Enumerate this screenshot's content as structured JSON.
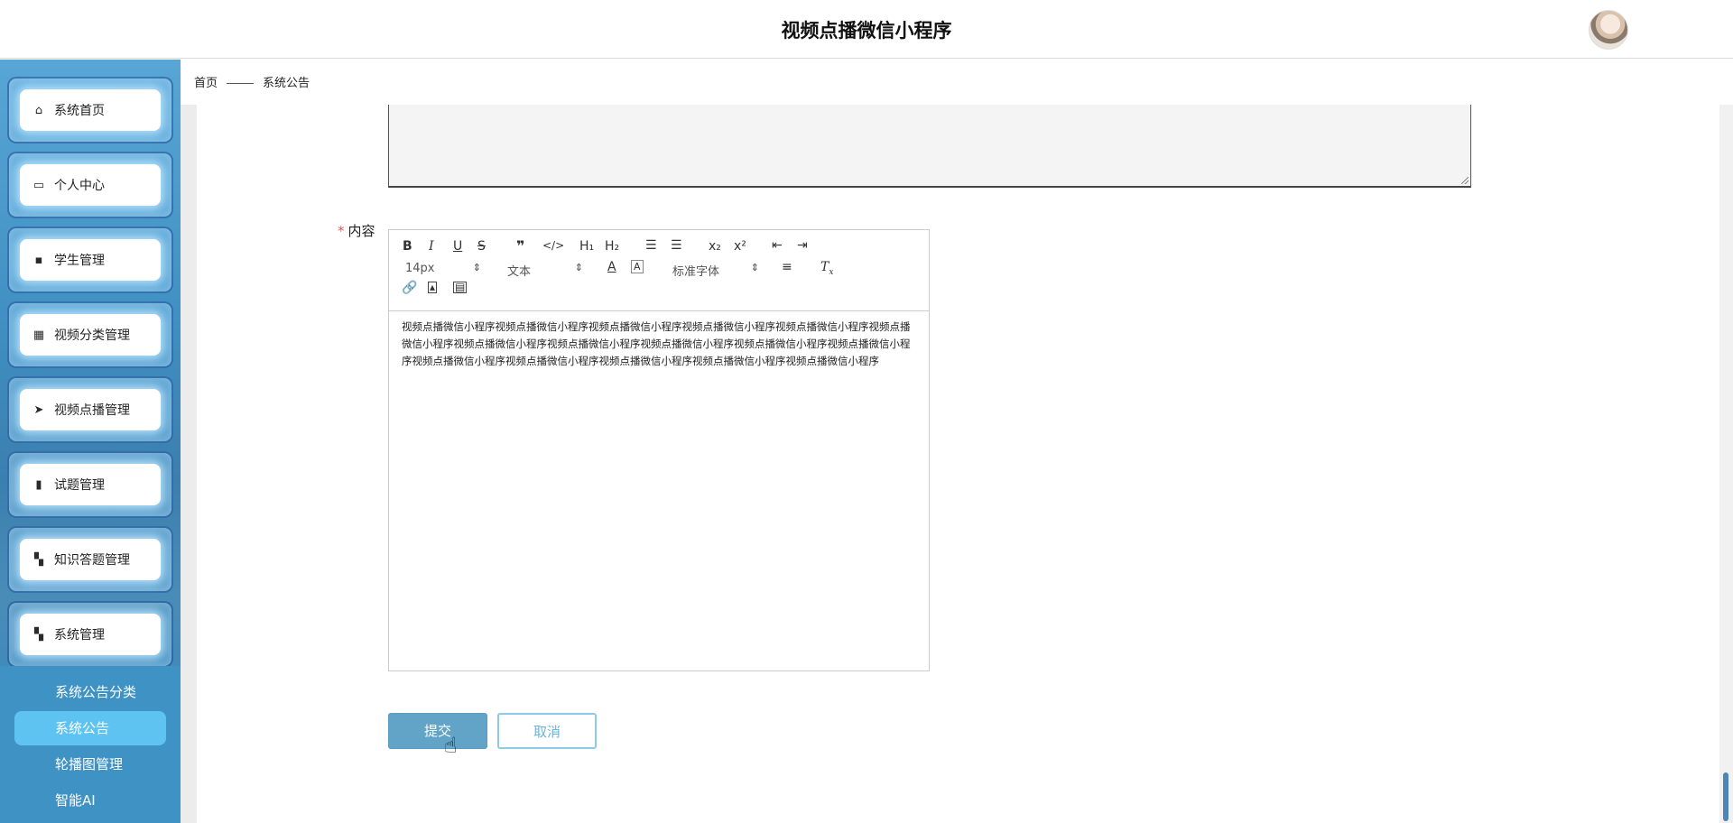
{
  "app": {
    "title": "视频点播微信小程序"
  },
  "sidebar": {
    "items": [
      {
        "label": "系统首页",
        "icon": "home-icon"
      },
      {
        "label": "个人中心",
        "icon": "card-icon"
      },
      {
        "label": "学生管理",
        "icon": "chat-icon"
      },
      {
        "label": "视频分类管理",
        "icon": "grid-icon"
      },
      {
        "label": "视频点播管理",
        "icon": "send-icon"
      },
      {
        "label": "试题管理",
        "icon": "bar-chart-icon"
      },
      {
        "label": "知识答题管理",
        "icon": "apps-icon"
      },
      {
        "label": "系统管理",
        "icon": "apps-icon"
      }
    ],
    "submenu": [
      {
        "label": "系统公告分类"
      },
      {
        "label": "系统公告",
        "active": true
      },
      {
        "label": "轮播图管理"
      },
      {
        "label": "智能AI"
      }
    ]
  },
  "breadcrumb": {
    "home": "首页",
    "current": "系统公告"
  },
  "form": {
    "content_label": "内容",
    "required_mark": "*",
    "editor": {
      "font_size": "14px",
      "block_type": "文本",
      "font_family": "标准字体",
      "body": "视频点播微信小程序视频点播微信小程序视频点播微信小程序视频点播微信小程序视频点播微信小程序视频点播微信小程序视频点播微信小程序视频点播微信小程序视频点播微信小程序视频点播微信小程序视频点播微信小程序视频点播微信小程序视频点播微信小程序视频点播微信小程序视频点播微信小程序视频点播微信小程序"
    },
    "submit_label": "提交",
    "cancel_label": "取消"
  },
  "colors": {
    "accent": "#61a4c7",
    "active_sub": "#5ec3f0",
    "sidebar": "#3f92c4"
  }
}
